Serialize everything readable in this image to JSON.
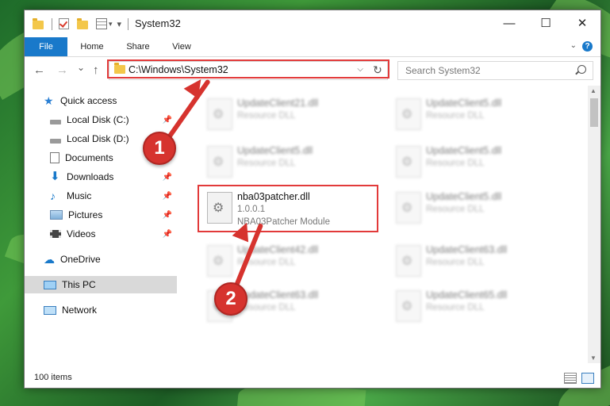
{
  "window": {
    "title": "System32",
    "minimize_glyph": "—",
    "maximize_glyph": "☐",
    "close_glyph": "✕"
  },
  "ribbon": {
    "tabs": [
      "File",
      "Home",
      "Share",
      "View"
    ],
    "help_glyph": "?"
  },
  "nav": {
    "back_glyph": "←",
    "forward_glyph": "→",
    "recent_glyph": "⌄",
    "up_glyph": "↑",
    "address": "C:\\Windows\\System32",
    "refresh_glyph": "↻",
    "search_placeholder": "Search System32"
  },
  "sidebar": {
    "items": [
      {
        "label": "Quick access",
        "icon": "star-icon"
      },
      {
        "label": "Local Disk (C:)",
        "icon": "drive-icon"
      },
      {
        "label": "Local Disk (D:)",
        "icon": "drive-icon"
      },
      {
        "label": "Documents",
        "icon": "documents-icon"
      },
      {
        "label": "Downloads",
        "icon": "download-icon"
      },
      {
        "label": "Music",
        "icon": "music-icon"
      },
      {
        "label": "Pictures",
        "icon": "pictures-icon"
      },
      {
        "label": "Videos",
        "icon": "videos-icon"
      },
      {
        "label": "OneDrive",
        "icon": "cloud-icon"
      },
      {
        "label": "This PC",
        "icon": "computer-icon"
      },
      {
        "label": "Network",
        "icon": "network-icon"
      }
    ]
  },
  "files": [
    {
      "name": "UpdateClient21.dll",
      "line2": "Resource DLL",
      "line3": ""
    },
    {
      "name": "UpdateClient5.dll",
      "line2": "Resource DLL",
      "line3": ""
    },
    {
      "name": "UpdateClient5.dll",
      "line2": "Resource DLL",
      "line3": ""
    },
    {
      "name": "UpdateClient5.dll",
      "line2": "Resource DLL",
      "line3": ""
    },
    {
      "name": "nba03patcher.dll",
      "line2": "1.0.0.1",
      "line3": "NBA03Patcher Module"
    },
    {
      "name": "UpdateClient5.dll",
      "line2": "Resource DLL",
      "line3": ""
    },
    {
      "name": "UpdateClient42.dll",
      "line2": "Resource DLL",
      "line3": ""
    },
    {
      "name": "UpdateClient63.dll",
      "line2": "Resource DLL",
      "line3": ""
    },
    {
      "name": "UpdateClient63.dll",
      "line2": "Resource DLL",
      "line3": ""
    },
    {
      "name": "UpdateClient65.dll",
      "line2": "Resource DLL",
      "line3": ""
    }
  ],
  "status": {
    "item_count": "100 items"
  },
  "callouts": [
    "1",
    "2"
  ],
  "colors": {
    "accent": "#1979ca",
    "highlight": "#e23a3a"
  }
}
